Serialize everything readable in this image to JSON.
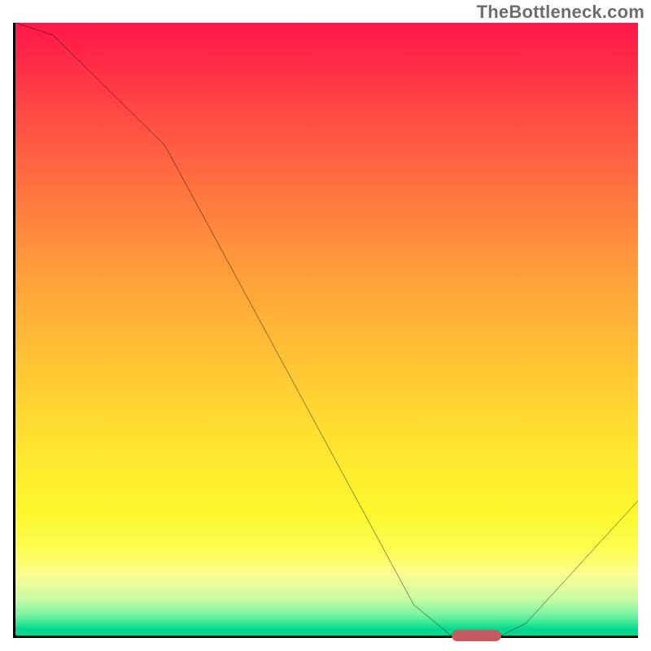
{
  "watermark": "TheBottleneck.com",
  "chart_data": {
    "type": "line",
    "title": "",
    "xlabel": "",
    "ylabel": "",
    "xlim": [
      0,
      100
    ],
    "ylim": [
      0,
      100
    ],
    "grid": false,
    "legend": false,
    "series": [
      {
        "name": "bottleneck-curve",
        "x": [
          0,
          6,
          16,
          24,
          64,
          70,
          78,
          82,
          100
        ],
        "values": [
          100,
          98,
          88,
          80,
          5,
          0,
          0,
          2,
          22
        ]
      }
    ],
    "marker": {
      "name": "optimal-range",
      "x_start": 70,
      "x_end": 78,
      "y": 0,
      "color": "#c65a5f"
    },
    "background_gradient": {
      "top": "#ff1748",
      "mid_upper": "#ff763f",
      "mid": "#ffe62f",
      "mid_lower": "#fcfd90",
      "bottom": "#00d890"
    }
  }
}
